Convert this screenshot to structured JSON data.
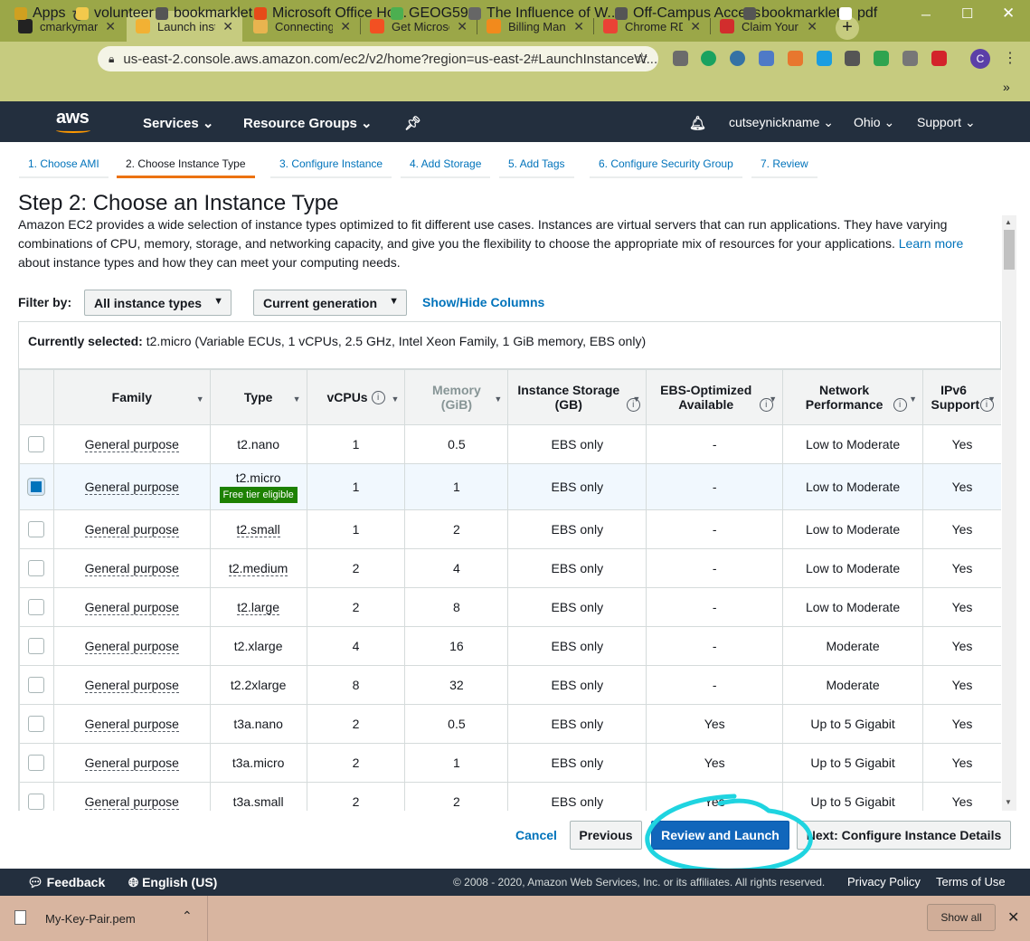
{
  "browser": {
    "tabs": [
      {
        "label": "cmarkymark",
        "favicon_color": "#222222"
      },
      {
        "label": "Launch insta",
        "favicon_color": "#f2b134"
      },
      {
        "label": "Connecting",
        "favicon_color": "#e8b44f"
      },
      {
        "label": "Get Microso",
        "favicon_color": "#f25022"
      },
      {
        "label": "Billing Mana",
        "favicon_color": "#f28a1c"
      },
      {
        "label": "Chrome RDP",
        "favicon_color": "#ea4335"
      },
      {
        "label": "Claim Your A",
        "favicon_color": "#d22d2d"
      }
    ],
    "active_tab_index": 1,
    "new_tab_glyph": "+",
    "address": "us-east-2.console.aws.amazon.com/ec2/v2/home?region=us-east-2#LaunchInstanceW...",
    "profile_initial": "C",
    "bookmarks": [
      "Apps",
      "volunteer",
      "bookmarklet",
      "Microsoft Office Ho...",
      "GEOG594",
      "The Influence of W...",
      "Off-Campus Access",
      "bookmarklet",
      "pdf"
    ],
    "bookmarks_overflow": "»"
  },
  "aws_header": {
    "logo": "aws",
    "services": "Services",
    "resource_groups": "Resource Groups",
    "account": "cutseynickname",
    "region": "Ohio",
    "support": "Support"
  },
  "wizard": {
    "steps": [
      "1. Choose AMI",
      "2. Choose Instance Type",
      "3. Configure Instance",
      "4. Add Storage",
      "5. Add Tags",
      "6. Configure Security Group",
      "7. Review"
    ],
    "active_step_index": 1,
    "title": "Step 2: Choose an Instance Type",
    "description_1": "Amazon EC2 provides a wide selection of instance types optimized to fit different use cases. Instances are virtual servers that can run applications. They have varying combinations of CPU, memory, storage, and networking capacity, and give you the flexibility to choose the appropriate mix of resources for your applications.",
    "learn_more": "Learn more",
    "description_2": "about instance types and how they can meet your computing needs."
  },
  "filter": {
    "label": "Filter by:",
    "instance_types": "All instance types",
    "generation": "Current generation",
    "show_hide": "Show/Hide Columns"
  },
  "currently_selected": {
    "label": "Currently selected:",
    "value": "t2.micro (Variable ECUs, 1 vCPUs, 2.5 GHz, Intel Xeon Family, 1 GiB memory, EBS only)"
  },
  "table": {
    "headers": {
      "family": "Family",
      "type": "Type",
      "vcpus": "vCPUs",
      "memory": "Memory (GiB)",
      "storage": "Instance Storage (GB)",
      "ebs": "EBS-Optimized Available",
      "network": "Network Performance",
      "ipv6": "IPv6 Support"
    },
    "free_tier_label": "Free tier eligible",
    "rows": [
      {
        "family": "General purpose",
        "type": "t2.nano",
        "vcpus": "1",
        "memory": "0.5",
        "storage": "EBS only",
        "ebs": "-",
        "network": "Low to Moderate",
        "ipv6": "Yes",
        "selected": false
      },
      {
        "family": "General purpose",
        "type": "t2.micro",
        "vcpus": "1",
        "memory": "1",
        "storage": "EBS only",
        "ebs": "-",
        "network": "Low to Moderate",
        "ipv6": "Yes",
        "selected": true
      },
      {
        "family": "General purpose",
        "type": "t2.small",
        "vcpus": "1",
        "memory": "2",
        "storage": "EBS only",
        "ebs": "-",
        "network": "Low to Moderate",
        "ipv6": "Yes",
        "selected": false
      },
      {
        "family": "General purpose",
        "type": "t2.medium",
        "vcpus": "2",
        "memory": "4",
        "storage": "EBS only",
        "ebs": "-",
        "network": "Low to Moderate",
        "ipv6": "Yes",
        "selected": false
      },
      {
        "family": "General purpose",
        "type": "t2.large",
        "vcpus": "2",
        "memory": "8",
        "storage": "EBS only",
        "ebs": "-",
        "network": "Low to Moderate",
        "ipv6": "Yes",
        "selected": false
      },
      {
        "family": "General purpose",
        "type": "t2.xlarge",
        "vcpus": "4",
        "memory": "16",
        "storage": "EBS only",
        "ebs": "-",
        "network": "Moderate",
        "ipv6": "Yes",
        "selected": false
      },
      {
        "family": "General purpose",
        "type": "t2.2xlarge",
        "vcpus": "8",
        "memory": "32",
        "storage": "EBS only",
        "ebs": "-",
        "network": "Moderate",
        "ipv6": "Yes",
        "selected": false
      },
      {
        "family": "General purpose",
        "type": "t3a.nano",
        "vcpus": "2",
        "memory": "0.5",
        "storage": "EBS only",
        "ebs": "Yes",
        "network": "Up to 5 Gigabit",
        "ipv6": "Yes",
        "selected": false
      },
      {
        "family": "General purpose",
        "type": "t3a.micro",
        "vcpus": "2",
        "memory": "1",
        "storage": "EBS only",
        "ebs": "Yes",
        "network": "Up to 5 Gigabit",
        "ipv6": "Yes",
        "selected": false
      },
      {
        "family": "General purpose",
        "type": "t3a.small",
        "vcpus": "2",
        "memory": "2",
        "storage": "EBS only",
        "ebs": "Yes",
        "network": "Up to 5 Gigabit",
        "ipv6": "Yes",
        "selected": false
      }
    ]
  },
  "actions": {
    "cancel": "Cancel",
    "previous": "Previous",
    "review_launch": "Review and Launch",
    "next": "Next: Configure Instance Details"
  },
  "footer": {
    "feedback": "Feedback",
    "language": "English (US)",
    "copyright": "© 2008 - 2020, Amazon Web Services, Inc. or its affiliates. All rights reserved.",
    "privacy": "Privacy Policy",
    "terms": "Terms of Use"
  },
  "downloads": {
    "file": "My-Key-Pair.pem",
    "show_all": "Show all"
  },
  "colors": {
    "aws_nav": "#232f3e",
    "browser_frame": "#9ba748",
    "primary_button": "#1166bb",
    "link": "#0073bb",
    "active_step": "#ec7211",
    "free_tier": "#1d8102",
    "annotation": "#1fd4e0"
  }
}
